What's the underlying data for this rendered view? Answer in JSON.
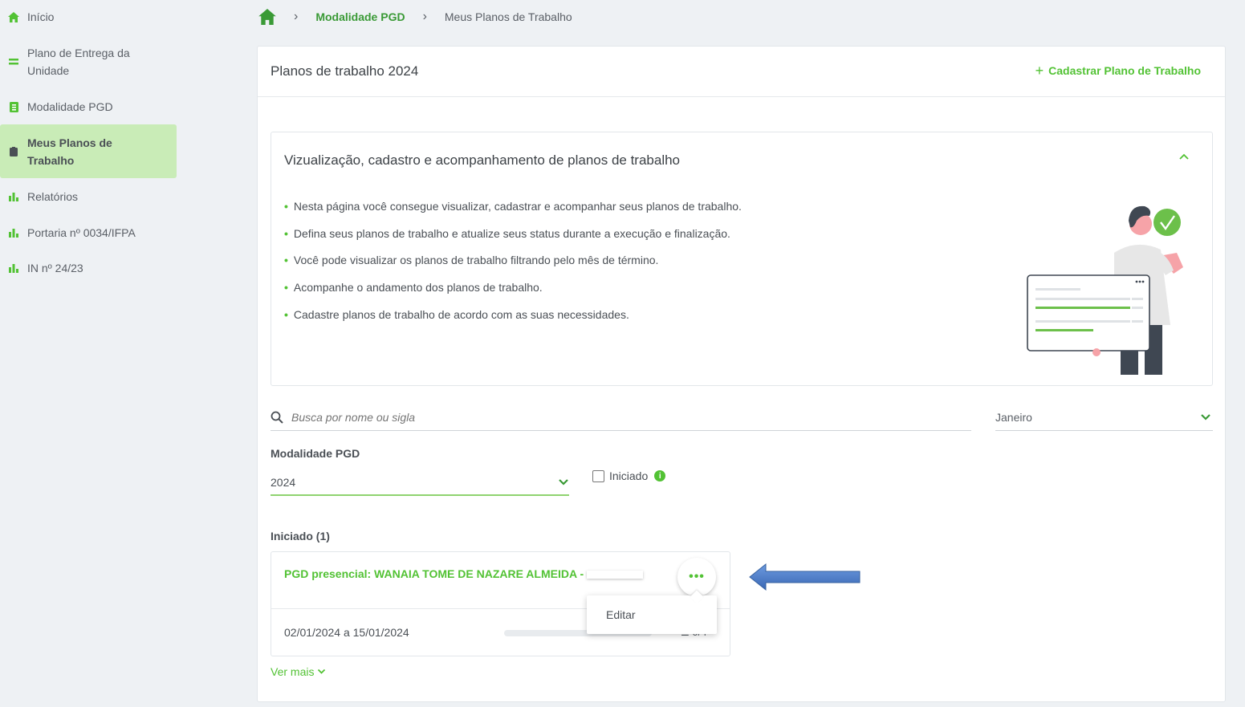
{
  "colors": {
    "accent": "#52c234",
    "accent_dark": "#3a9a36",
    "active_bg": "#c9ecb7",
    "arrow": "#4a78c2"
  },
  "sidebar": {
    "items": [
      {
        "label": "Início",
        "icon": "home-icon",
        "active": false
      },
      {
        "label": "Plano de Entrega da Unidade",
        "icon": "list-icon",
        "active": false
      },
      {
        "label": "Modalidade PGD",
        "icon": "document-icon",
        "active": false
      },
      {
        "label": "Meus Planos de Trabalho",
        "icon": "clipboard-icon",
        "active": true
      },
      {
        "label": "Relatórios",
        "icon": "bar-chart-icon",
        "active": false
      },
      {
        "label": "Portaria nº 0034/IFPA",
        "icon": "bar-chart-icon",
        "active": false
      },
      {
        "label": "IN nº 24/23",
        "icon": "bar-chart-icon",
        "active": false
      }
    ]
  },
  "breadcrumb": {
    "home_icon": "home-icon",
    "items": [
      "Modalidade PGD",
      "Meus Planos de Trabalho"
    ]
  },
  "main": {
    "title": "Planos de trabalho 2024",
    "add_button": "Cadastrar Plano de Trabalho",
    "info": {
      "title": "Vizualização, cadastro e acompanhamento de planos de trabalho",
      "bullets": [
        "Nesta página você consegue visualizar, cadastrar e acompanhar seus planos de trabalho.",
        "Defina seus planos de trabalho e atualize seus status durante a execução e finalização.",
        "Você pode visualizar os planos de trabalho filtrando pelo mês de término.",
        "Acompanhe o andamento dos planos de trabalho.",
        "Cadastre planos de trabalho de acordo com as suas necessidades."
      ]
    },
    "filters": {
      "search_placeholder": "Busca por nome ou sigla",
      "month": "Janeiro",
      "modalidade_label": "Modalidade PGD",
      "year": "2024",
      "checkbox_label": "Iniciado",
      "checkbox_checked": false
    },
    "section": {
      "label": "Iniciado (1)",
      "plan": {
        "title": "PGD presencial: WANAIA TOME DE NAZARE ALMEIDA -",
        "dates": "02/01/2024 a 15/01/2024",
        "count": "0/4",
        "progress": 0,
        "menu_dots": "•••",
        "menu_items": [
          "Editar"
        ]
      }
    },
    "ver_mais": "Ver mais"
  }
}
